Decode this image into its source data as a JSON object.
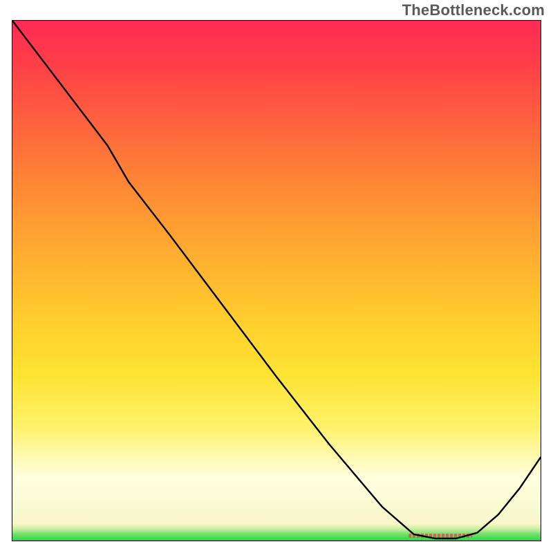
{
  "attribution": "TheBottleneck.com",
  "chart_data": {
    "type": "line",
    "title": "",
    "xlabel": "",
    "ylabel": "",
    "xlim": [
      0,
      100
    ],
    "ylim": [
      0,
      100
    ],
    "x": [
      0,
      6,
      12,
      18,
      22,
      30,
      40,
      50,
      60,
      70,
      76,
      80,
      84,
      88,
      92,
      96,
      100
    ],
    "y": [
      100,
      92,
      84,
      76,
      69,
      58.5,
      45,
      31.5,
      18.5,
      6.5,
      1.2,
      0.4,
      0.4,
      1.5,
      5,
      10,
      16
    ],
    "min_marker": {
      "x_start": 75,
      "x_end": 87,
      "y": 0.5
    },
    "note": "y is percent height from bottom; curve is a qualitative bottleneck curve with knee ~x=22 and valley ~x=80-86"
  }
}
